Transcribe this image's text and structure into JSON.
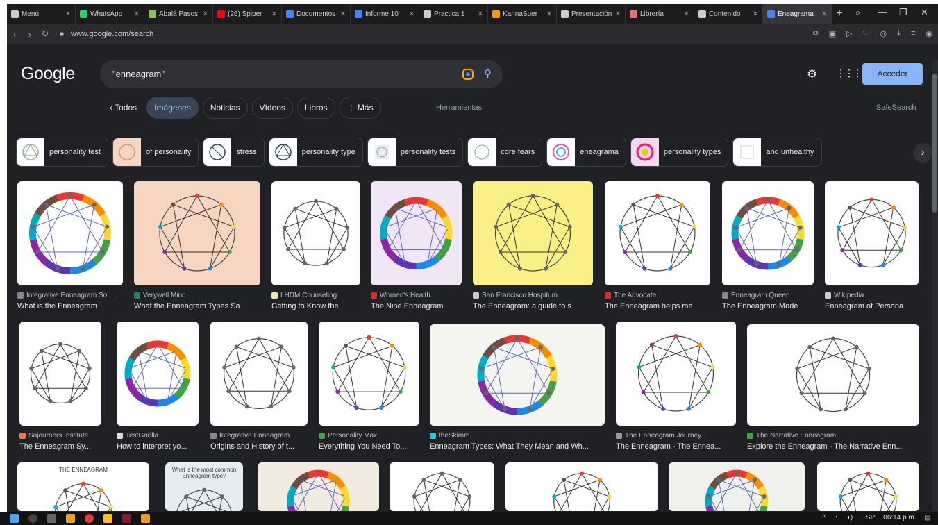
{
  "tabs": [
    {
      "label": "Menú",
      "color": "#cccccc"
    },
    {
      "label": "WhatsApp",
      "color": "#25d366"
    },
    {
      "label": "Abalá Pasos",
      "color": "#8bc34a"
    },
    {
      "label": "(26) Spiper",
      "color": "#ff0000"
    },
    {
      "label": "Documentos",
      "color": "#4285f4"
    },
    {
      "label": "Informe 10",
      "color": "#4285f4"
    },
    {
      "label": "Practica 1",
      "color": "#cccccc"
    },
    {
      "label": "KarinaSuer",
      "color": "#ff9800"
    },
    {
      "label": "Presentación",
      "color": "#cccccc"
    },
    {
      "label": "Librería",
      "color": "#e57373"
    },
    {
      "label": "Contenido",
      "color": "#cccccc"
    },
    {
      "label": "Eneagrama",
      "color": "#4285f4"
    }
  ],
  "address": {
    "url": "www.google.com/search"
  },
  "google": {
    "logo": "Google",
    "query": "\"enneagram\"",
    "signin_label": "Acceder"
  },
  "filters": {
    "back": "‹ Todos",
    "items": [
      "Imágenes",
      "Noticias",
      "Vídeos",
      "Libros",
      "⋮ Más"
    ],
    "tools": "Herramientas",
    "safesearch": "SafeSearch"
  },
  "suggestions": [
    "personality test",
    "of personality",
    "stress",
    "personality type",
    "personality tests",
    "core fears",
    "eneagrama",
    "personality types",
    "and unhealthy"
  ],
  "results": [
    {
      "source": "Integrative Enneagram So...",
      "title": "What is the Enneagram",
      "bg": "#ffffff",
      "favicon": "#888888"
    },
    {
      "source": "Verywell Mind",
      "title": "What the Enneagram Types Sa",
      "bg": "#f6d6c0",
      "favicon": "#2e7d6b"
    },
    {
      "source": "LHDM Counseling",
      "title": "Getting to Know the",
      "bg": "#ffffff",
      "favicon": "#f2e7b0"
    },
    {
      "source": "Women's Health",
      "title": "The Nine Enneagram",
      "bg": "#f1e6f6",
      "favicon": "#d32f2f"
    },
    {
      "source": "San Francisco Hospitum",
      "title": "The Enneagram: a guide to s",
      "bg": "#fbf085",
      "favicon": "#cccccc"
    },
    {
      "source": "The Advocate",
      "title": "The Enneagram helps me",
      "bg": "#ffffff",
      "favicon": "#d32f2f"
    },
    {
      "source": "Enneagram Queen",
      "title": "The Enneagram Mode",
      "bg": "#ffffff",
      "favicon": "#888888"
    },
    {
      "source": "Wikipedia",
      "title": "Enneagram of Persona",
      "bg": "#ffffff",
      "favicon": "#cccccc"
    },
    {
      "source": "Sojourners Institute",
      "title": "The Enneagram Sy...",
      "bg": "#ffffff",
      "favicon": "#ff7043"
    },
    {
      "source": "TestGorilla",
      "title": "How to interpret yo...",
      "bg": "#ffffff",
      "favicon": "#dddddd"
    },
    {
      "source": "Integrative Enneagram",
      "title": "Origins and History of t...",
      "bg": "#ffffff",
      "favicon": "#888888"
    },
    {
      "source": "Personality Max",
      "title": "Everything You Need To...",
      "bg": "#ffffff",
      "favicon": "#43a047"
    },
    {
      "source": "theSkimm",
      "title": "Enneagram Types: What They Mean and Wh...",
      "bg": "#f4f5f1",
      "favicon": "#26c6da"
    },
    {
      "source": "The Enneagram Journey",
      "title": "The Enneagram - The Ennea...",
      "bg": "#ffffff",
      "favicon": "#999999"
    },
    {
      "source": "The Narrative Enneagram",
      "title": "Explore the Enneagram - The Narrative Enn...",
      "bg": "#ffffff",
      "favicon": "#43a047"
    }
  ],
  "row3": [
    {
      "label": "THE ENNEAGRAM",
      "bg": "#ffffff"
    },
    {
      "label": "What is the most common Enneagram type?",
      "bg": "#e3edf2"
    },
    {
      "label": "",
      "bg": "#f1ebe0"
    },
    {
      "label": "",
      "bg": "#ffffff"
    },
    {
      "label": "",
      "bg": "#ffffff"
    },
    {
      "label": "",
      "bg": "#eef1ec"
    },
    {
      "label": "",
      "bg": "#ffffff"
    }
  ],
  "tray": {
    "lang": "ESP",
    "time": "06:14 p.m."
  }
}
